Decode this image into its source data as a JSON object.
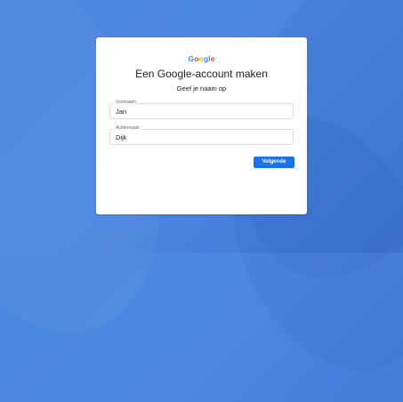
{
  "logo": {
    "letters": [
      "G",
      "o",
      "o",
      "g",
      "l",
      "e"
    ],
    "colors": [
      "#4285f4",
      "#ea4335",
      "#fbbc05",
      "#4285f4",
      "#34a853",
      "#ea4335"
    ]
  },
  "card": {
    "title": "Een Google-account maken",
    "subtitle": "Geef je naam op"
  },
  "fields": {
    "first_name": {
      "label": "Voornaam",
      "value": "Jan"
    },
    "last_name": {
      "label": "Achternaam",
      "value": "Dijk"
    }
  },
  "buttons": {
    "next_label": "Volgende"
  },
  "colors": {
    "background": "#4a86e0",
    "accent": "#1a73e8"
  }
}
